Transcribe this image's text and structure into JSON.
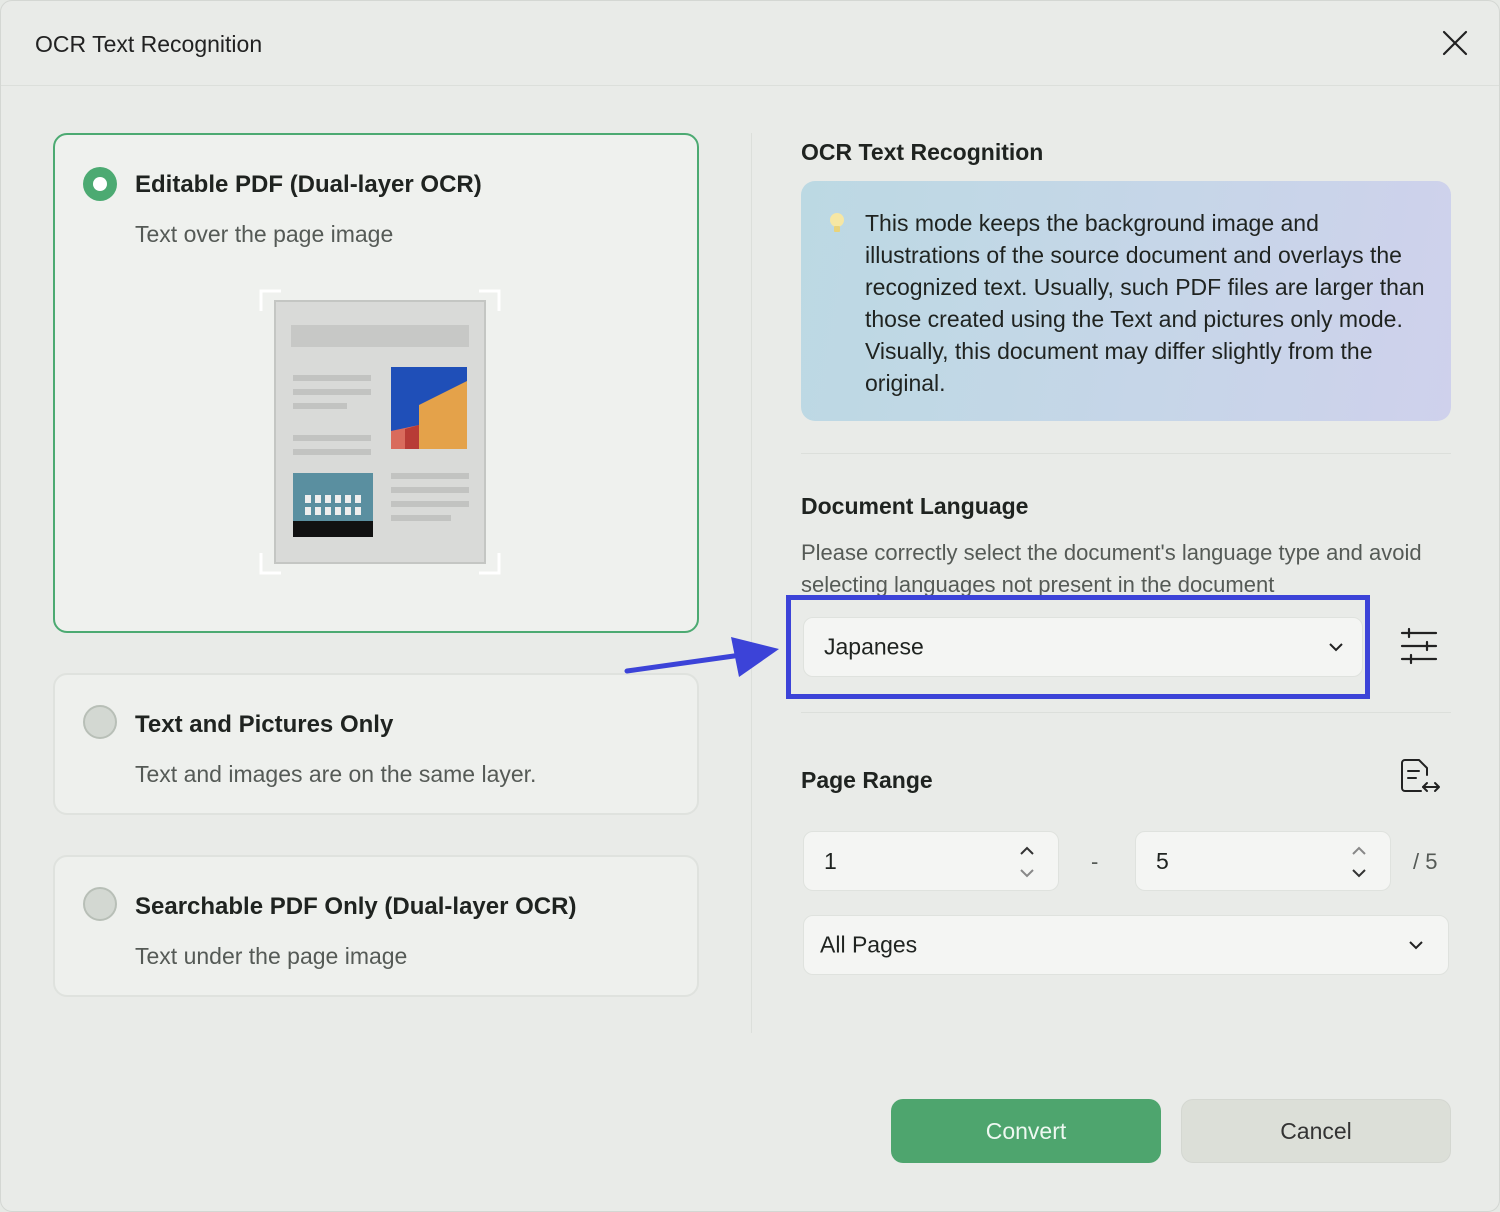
{
  "dialog": {
    "title": "OCR Text Recognition",
    "close_icon": "close-icon"
  },
  "modes": [
    {
      "title": "Editable PDF (Dual-layer OCR)",
      "subtitle": "Text over the page image",
      "selected": true
    },
    {
      "title": "Text and Pictures Only",
      "subtitle": "Text and images are on the same layer.",
      "selected": false
    },
    {
      "title": "Searchable PDF Only (Dual-layer OCR)",
      "subtitle": "Text under the page image",
      "selected": false
    }
  ],
  "ocr_section": {
    "title": "OCR Text Recognition",
    "info_icon": "lightbulb-icon",
    "info_text": "This mode keeps the background image and illustrations of the source document and overlays the recognized text. Usually, such PDF files are larger than those created using the Text and pictures only mode. Visually, this document may differ slightly from the original."
  },
  "language": {
    "title": "Document Language",
    "description": "Please correctly select the document's language type and avoid selecting languages not present in the document",
    "selected": "Japanese",
    "settings_icon": "sliders-icon"
  },
  "page_range": {
    "title": "Page Range",
    "icon": "page-swap-icon",
    "from": "1",
    "separator": "-",
    "to": "5",
    "total": "/ 5",
    "scope": "All Pages"
  },
  "buttons": {
    "convert": "Convert",
    "cancel": "Cancel"
  },
  "colors": {
    "accent_green": "#4caa72",
    "highlight_blue": "#3c43d8"
  }
}
